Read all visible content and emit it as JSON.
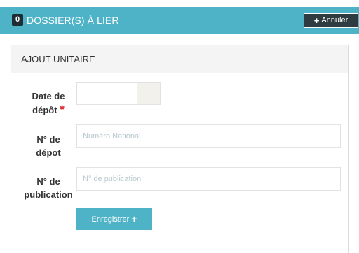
{
  "header": {
    "count": "0",
    "title": "DOSSIER(S) À LIER",
    "cancel_label": "Annuler",
    "cancel_icon": "plus-icon"
  },
  "panel": {
    "title": "AJOUT UNITAIRE"
  },
  "form": {
    "date_label_line1": "Date de",
    "date_label_line2": "dépôt",
    "date_value": "",
    "depot_number_label_line1": "N° de",
    "depot_number_label_line2": "dépot",
    "depot_number_placeholder": "Numéro National",
    "depot_number_value": "",
    "publication_label_line1": "N° de",
    "publication_label_line2": "publication",
    "publication_placeholder": "N° de publication",
    "publication_value": "",
    "required_marker": "*",
    "save_label": "Enregistrer",
    "save_icon": "plus-icon"
  },
  "colors": {
    "accent": "#4fb3c8",
    "badge": "#1d2d33",
    "required": "#d9262d",
    "header_bg": "#f4f4f4"
  }
}
